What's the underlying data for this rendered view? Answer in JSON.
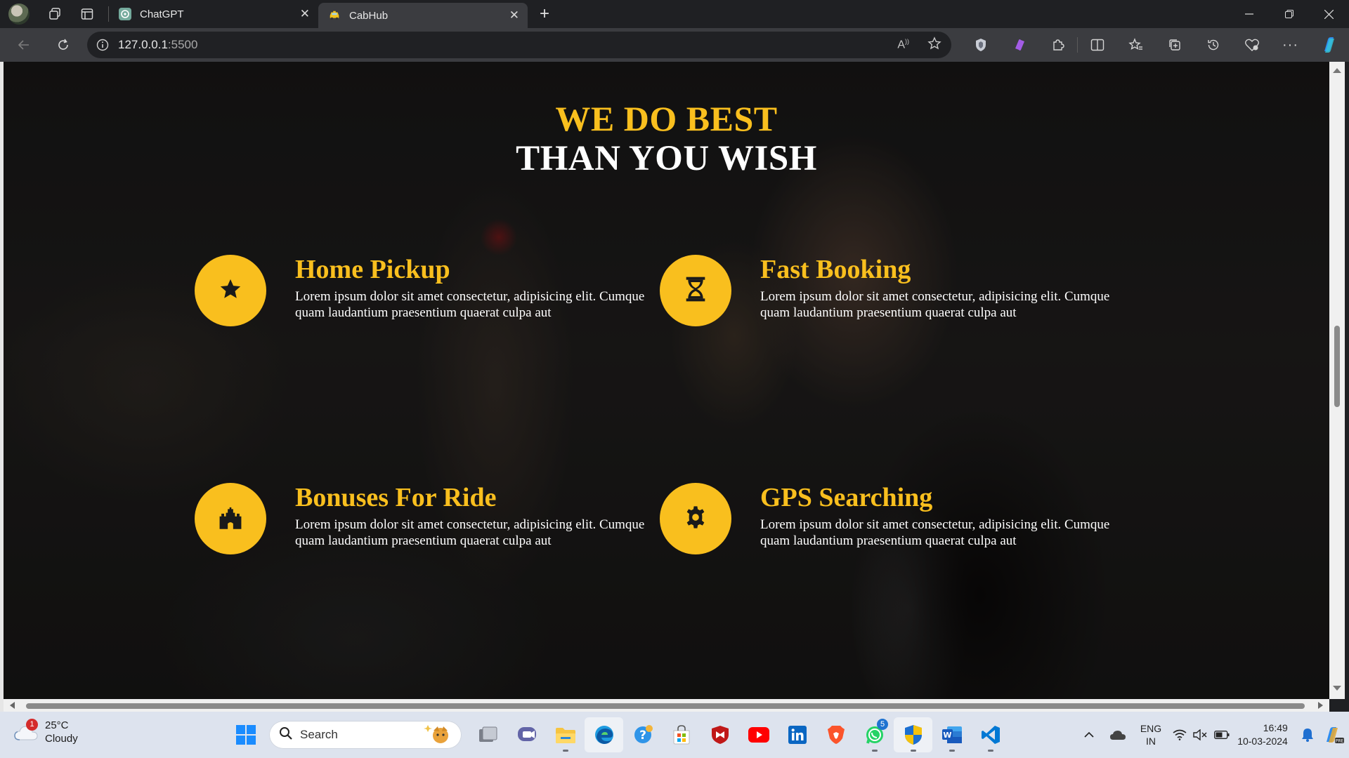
{
  "browser": {
    "tabs": [
      {
        "title": "ChatGPT",
        "active": false
      },
      {
        "title": "CabHub",
        "active": true
      }
    ],
    "address": {
      "host": "127.0.0.1",
      "port": ":5500"
    }
  },
  "page": {
    "headline_line1": "WE DO BEST",
    "headline_line2": "THAN YOU WISH",
    "features": [
      {
        "title": "Home Pickup",
        "icon": "star-icon",
        "text": "Lorem ipsum dolor sit amet consectetur, adipisicing elit. Cumque quam laudantium praesentium quaerat culpa aut"
      },
      {
        "title": "Fast Booking",
        "icon": "hourglass-icon",
        "text": "Lorem ipsum dolor sit amet consectetur, adipisicing elit. Cumque quam laudantium praesentium quaerat culpa aut"
      },
      {
        "title": "Bonuses For Ride",
        "icon": "castle-icon",
        "text": "Lorem ipsum dolor sit amet consectetur, adipisicing elit. Cumque quam laudantium praesentium quaerat culpa aut"
      },
      {
        "title": "GPS Searching",
        "icon": "gear-icon",
        "text": "Lorem ipsum dolor sit amet consectetur, adipisicing elit. Cumque quam laudantium praesentium quaerat culpa aut"
      }
    ],
    "colors": {
      "accent": "#f9bf1e",
      "text": "#ffffff"
    }
  },
  "taskbar": {
    "weather": {
      "temp": "25°C",
      "condition": "Cloudy",
      "badge": "1"
    },
    "search_label": "Search",
    "whatsapp_badge": "5",
    "lang_line1": "ENG",
    "lang_line2": "IN",
    "time": "16:49",
    "date": "10-03-2024"
  }
}
